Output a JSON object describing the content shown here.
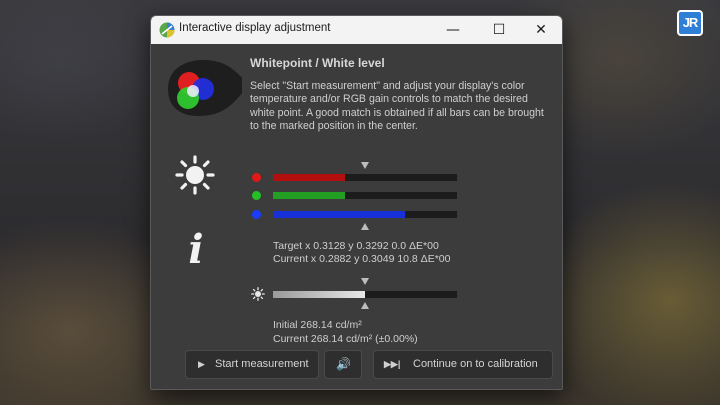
{
  "window": {
    "title": "Interactive display adjustment",
    "controls": {
      "minimize": "—",
      "maximize": "☐",
      "close": "✕"
    }
  },
  "icons": {
    "app": "displaycal-icon",
    "blob": "rgb-circles-icon",
    "sun": "sun-icon",
    "info": "info-icon",
    "info_glyph": "i"
  },
  "main": {
    "heading": "Whitepoint / White level",
    "instructions": "Select \"Start measurement\" and adjust your display's color temperature and/or RGB gain controls to match the desired white point. A good match is obtained if all bars can be brought to the marked position in the center."
  },
  "rgb_bars": [
    {
      "channel": "red",
      "color": "#e01818",
      "fill": "#b40f0f",
      "level": 0.39
    },
    {
      "channel": "green",
      "color": "#26c026",
      "fill": "#23a023",
      "level": 0.39
    },
    {
      "channel": "blue",
      "color": "#1a3cff",
      "fill": "#1730d8",
      "level": 0.72
    }
  ],
  "readouts": {
    "target": "Target x 0.3128 y 0.3292 0.0 ΔE*00",
    "current": "Current x 0.2882 y 0.3049 10.8 ΔE*00"
  },
  "white_level": {
    "level": 0.5,
    "fill": "#e8e8e8",
    "initial": "Initial 268.14 cd/m²",
    "current": "Current 268.14 cd/m² (±0.00%)"
  },
  "buttons": {
    "start_icon": "▶",
    "start": "Start measurement",
    "sound_icon": "🔊",
    "continue_icon": "▶▶|",
    "continue": "Continue on to calibration"
  },
  "badge": {
    "text": "JR"
  }
}
